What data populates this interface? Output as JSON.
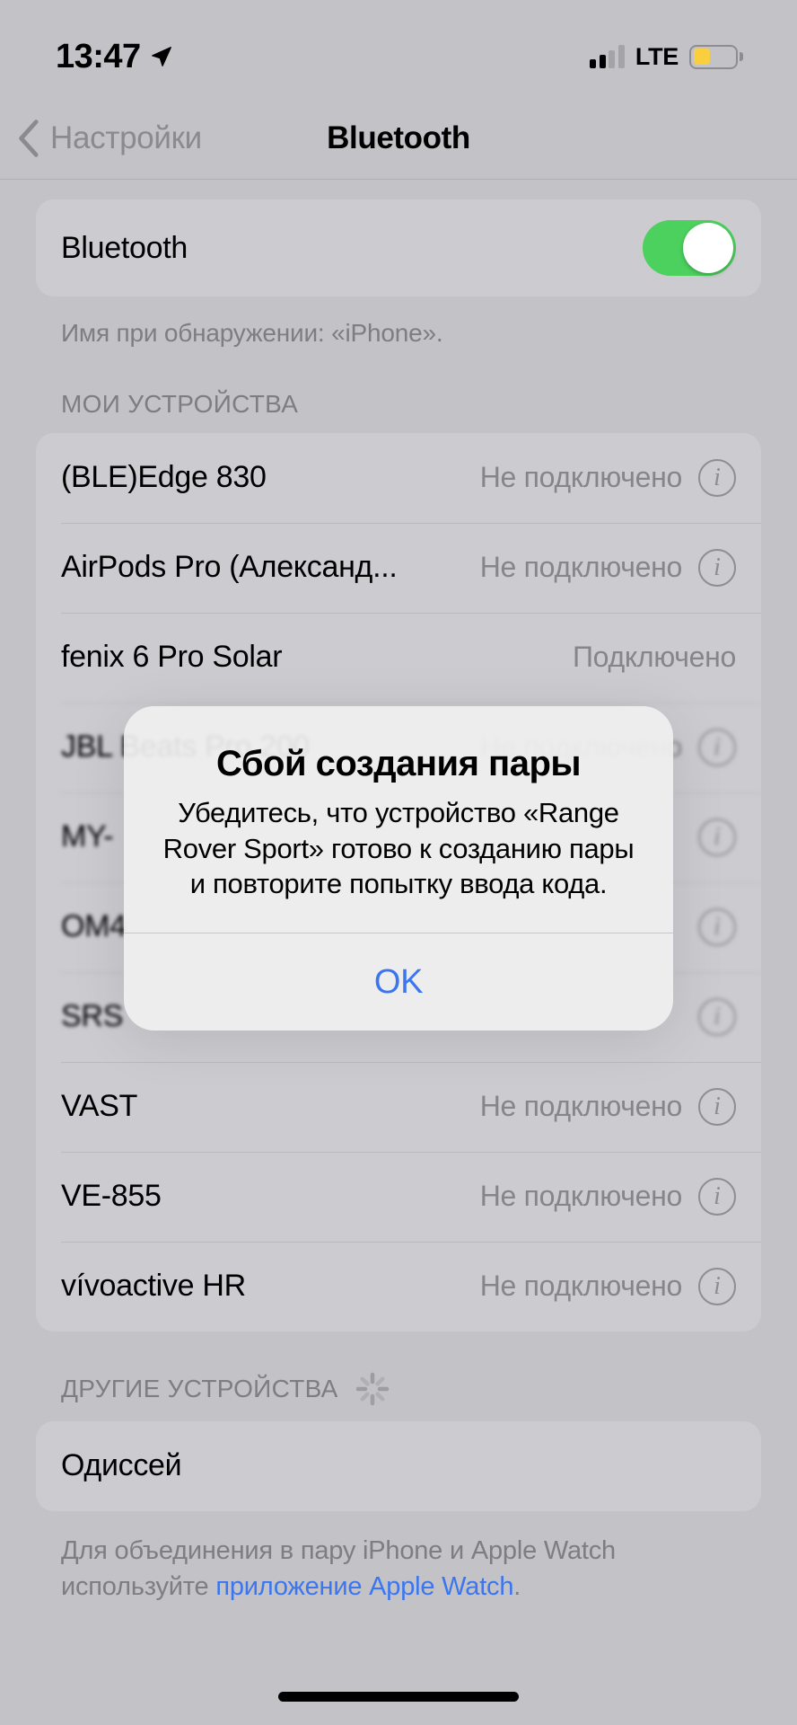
{
  "status_bar": {
    "time": "13:47",
    "location_icon": "location-arrow-icon",
    "carrier_tech": "LTE",
    "signal_bars_active": 2,
    "signal_bars_total": 4,
    "battery_percent": 40,
    "battery_color": "#f9cf3f"
  },
  "nav": {
    "back_label": "Настройки",
    "title": "Bluetooth"
  },
  "bluetooth": {
    "label": "Bluetooth",
    "enabled": true,
    "toggle_color": "#4cd05e",
    "footnote": "Имя при обнаружении: «iPhone»."
  },
  "my_devices": {
    "header": "МОИ УСТРОЙСТВА",
    "items": [
      {
        "name": "(BLE)Edge 830",
        "status": "Не подключено",
        "has_info": true
      },
      {
        "name": "AirPods Pro (Александ...",
        "status": "Не подключено",
        "has_info": true
      },
      {
        "name": "fenix 6 Pro Solar",
        "status": "Подключено",
        "has_info": false
      },
      {
        "name": "JBL Beats Pro 200",
        "status": "Не подключено",
        "has_info": true
      },
      {
        "name": "MY-",
        "status": "",
        "has_info": true
      },
      {
        "name": "OM4",
        "status": "",
        "has_info": true
      },
      {
        "name": "SRS",
        "status": "",
        "has_info": true
      },
      {
        "name": "VAST",
        "status": "Не подключено",
        "has_info": true
      },
      {
        "name": "VE-855",
        "status": "Не подключено",
        "has_info": true
      },
      {
        "name": "vívoactive HR",
        "status": "Не подключено",
        "has_info": true
      }
    ]
  },
  "other_devices": {
    "header": "ДРУГИЕ УСТРОЙСТВА",
    "spinner_icon": "loading-spinner-icon",
    "items": [
      {
        "name": "Одиссей"
      }
    ]
  },
  "footer": {
    "text_before": "Для объединения в пару iPhone и Apple Watch используйте ",
    "link_text": "приложение Apple Watch",
    "text_after": "."
  },
  "alert": {
    "title": "Сбой создания пары",
    "message": "Убедитесь, что устройство «Range Rover Sport» готово к созданию пары и повторите попытку ввода кода.",
    "ok_label": "OK",
    "ok_color": "#3b76f0"
  }
}
